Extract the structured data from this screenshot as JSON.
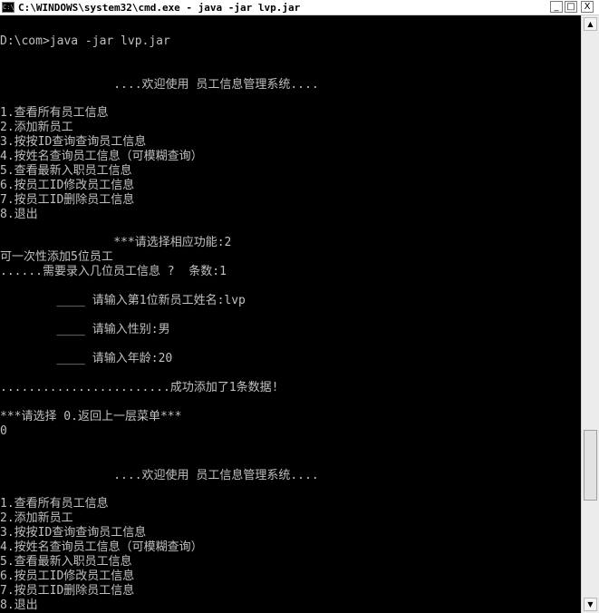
{
  "window": {
    "title": "C:\\WINDOWS\\system32\\cmd.exe - java -jar lvp.jar",
    "icon_text": "C:\\",
    "buttons": {
      "minimize": "_",
      "maximize": "□",
      "close": "X"
    }
  },
  "console": {
    "lines": [
      "D:\\com>java -jar lvp.jar",
      "                ....欢迎使用 员工信息管理系统....",
      "1.查看所有员工信息",
      "2.添加新员工",
      "3.按按ID查询查询员工信息",
      "4.按姓名查询员工信息（可模糊查询）",
      "5.查看最新入职员工信息",
      "6.按员工ID修改员工信息",
      "7.按员工ID删除员工信息",
      "8.退出",
      "                ***请选择相应功能:2",
      "可一次性添加5位员工",
      "......需要录入几位员工信息 ?  条数:1",
      "        ____ 请输入第1位新员工姓名:lvp",
      "        ____ 请输入性别:男",
      "        ____ 请输入年龄:20",
      "........................成功添加了1条数据!",
      "***请选择 0.返回上一层菜单***",
      "0",
      "                ....欢迎使用 员工信息管理系统....",
      "1.查看所有员工信息",
      "2.添加新员工",
      "3.按按ID查询查询员工信息",
      "4.按姓名查询员工信息（可模糊查询）",
      "5.查看最新入职员工信息",
      "6.按员工ID修改员工信息",
      "7.按员工ID删除员工信息",
      "8.退出"
    ]
  },
  "scrollbar": {
    "up_arrow": "▲",
    "down_arrow": "▼"
  }
}
